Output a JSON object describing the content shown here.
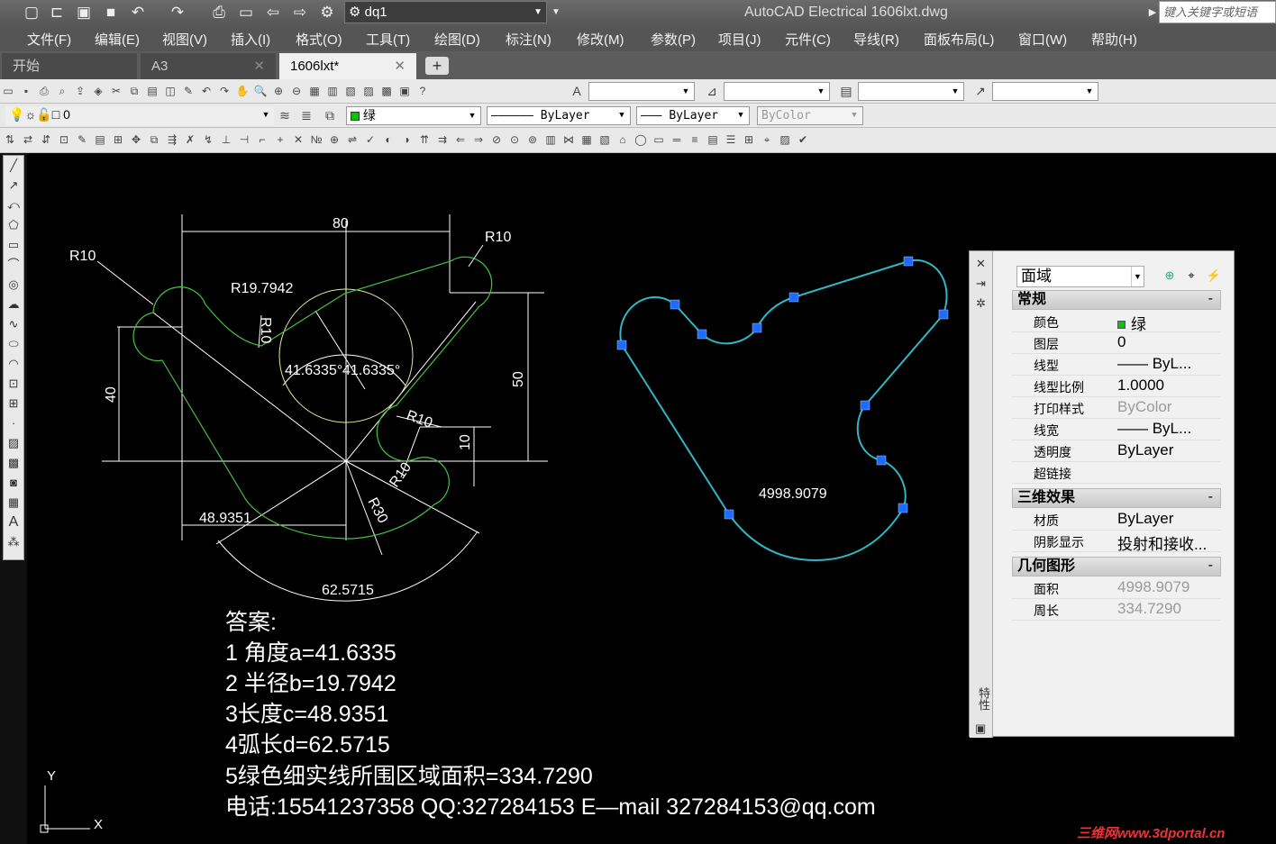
{
  "titlebar": {
    "workspace": "dq1",
    "app_title": "AutoCAD Electrical    1606lxt.dwg",
    "search_placeholder": "键入关键字或短语"
  },
  "menus": [
    "文件(F)",
    "编辑(E)",
    "视图(V)",
    "插入(I)",
    "格式(O)",
    "工具(T)",
    "绘图(D)",
    "标注(N)",
    "修改(M)",
    "参数(P)",
    "项目(J)",
    "元件(C)",
    "导线(R)",
    "面板布局(L)",
    "窗口(W)",
    "帮助(H)"
  ],
  "tabs": [
    {
      "label": "开始",
      "active": false,
      "closable": false
    },
    {
      "label": "A3",
      "active": false,
      "closable": true
    },
    {
      "label": "1606lxt*",
      "active": true,
      "closable": true
    }
  ],
  "layer_bar": {
    "layer": "0",
    "color": "绿",
    "linetype": "ByLayer",
    "lineweight": "ByLayer",
    "plotstyle": "ByColor"
  },
  "drawing": {
    "dims": {
      "d80": "80",
      "r10_a": "R10",
      "r10_b": "R10",
      "r19": "R19.7942",
      "r10_c": "R10",
      "d40": "40",
      "d50": "50",
      "ang1": "41.6335°",
      "ang2": "41.6335°",
      "r10_d": "R10",
      "d10": "10",
      "r10_e": "R10",
      "r30": "R30",
      "d48": "48.9351",
      "arc": "62.5715"
    },
    "region_area_label": "4998.9079",
    "answers": [
      "答案:",
      "1 角度a=41.6335",
      "2 半径b=19.7942",
      "3长度c=48.9351",
      "4弧长d=62.5715",
      "5绿色细实线所围区域面积=334.7290",
      "电话:15541237358   QQ:327284153   E—mail 327284153@qq.com"
    ],
    "ucs": {
      "y": "Y",
      "x": "X"
    }
  },
  "properties": {
    "object_type": "面域",
    "sections": {
      "general": "常规",
      "three_d": "三维效果",
      "geometry": "几何图形"
    },
    "general_rows": [
      {
        "k": "颜色",
        "v": "绿"
      },
      {
        "k": "图层",
        "v": "0"
      },
      {
        "k": "线型",
        "v": "—— ByL..."
      },
      {
        "k": "线型比例",
        "v": "1.0000"
      },
      {
        "k": "打印样式",
        "v": "ByColor"
      },
      {
        "k": "线宽",
        "v": "—— ByL..."
      },
      {
        "k": "透明度",
        "v": "ByLayer"
      },
      {
        "k": "超链接",
        "v": ""
      }
    ],
    "three_d_rows": [
      {
        "k": "材质",
        "v": "ByLayer"
      },
      {
        "k": "阴影显示",
        "v": "投射和接收..."
      }
    ],
    "geometry_rows": [
      {
        "k": "面积",
        "v": "4998.9079"
      },
      {
        "k": "周长",
        "v": "334.7290"
      }
    ],
    "side_title": "特性"
  },
  "watermark": "三维网www.3dportal.cn"
}
